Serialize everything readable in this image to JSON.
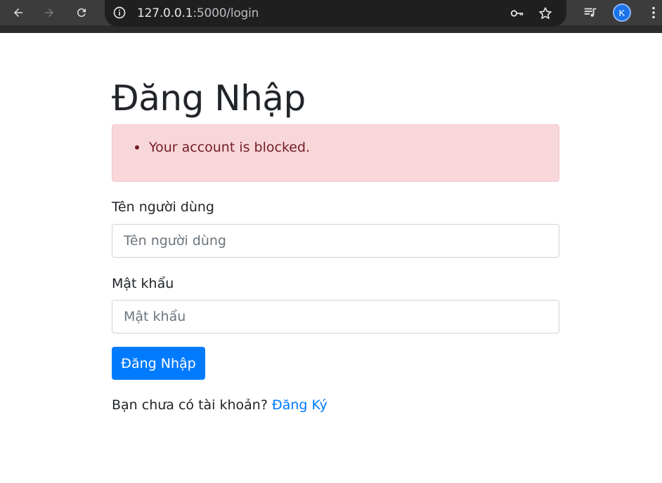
{
  "browser": {
    "url_host": "127.0.0.1",
    "url_rest": ":5000/login",
    "profile_initial": "K",
    "icons": [
      "back-icon",
      "forward-icon",
      "reload-icon",
      "site-info-icon",
      "password-key-icon",
      "bookmark-star-icon",
      "media-queue-icon",
      "menu-dots-icon"
    ]
  },
  "page": {
    "title": "Đăng Nhập",
    "alert": {
      "messages": [
        "Your account is blocked."
      ]
    },
    "form": {
      "username_label": "Tên người dùng",
      "username_placeholder": "Tên người dùng",
      "username_value": "",
      "password_label": "Mật khẩu",
      "password_placeholder": "Mật khẩu",
      "password_value": "",
      "submit_label": "Đăng Nhập"
    },
    "signup": {
      "prompt": "Bạn chưa có tài khoản?",
      "link_label": "Đăng Ký"
    }
  },
  "colors": {
    "chrome_bg": "#3c3c3c",
    "primary": "#007bff",
    "alert_bg": "#f8d7da",
    "alert_text": "#721c24"
  }
}
